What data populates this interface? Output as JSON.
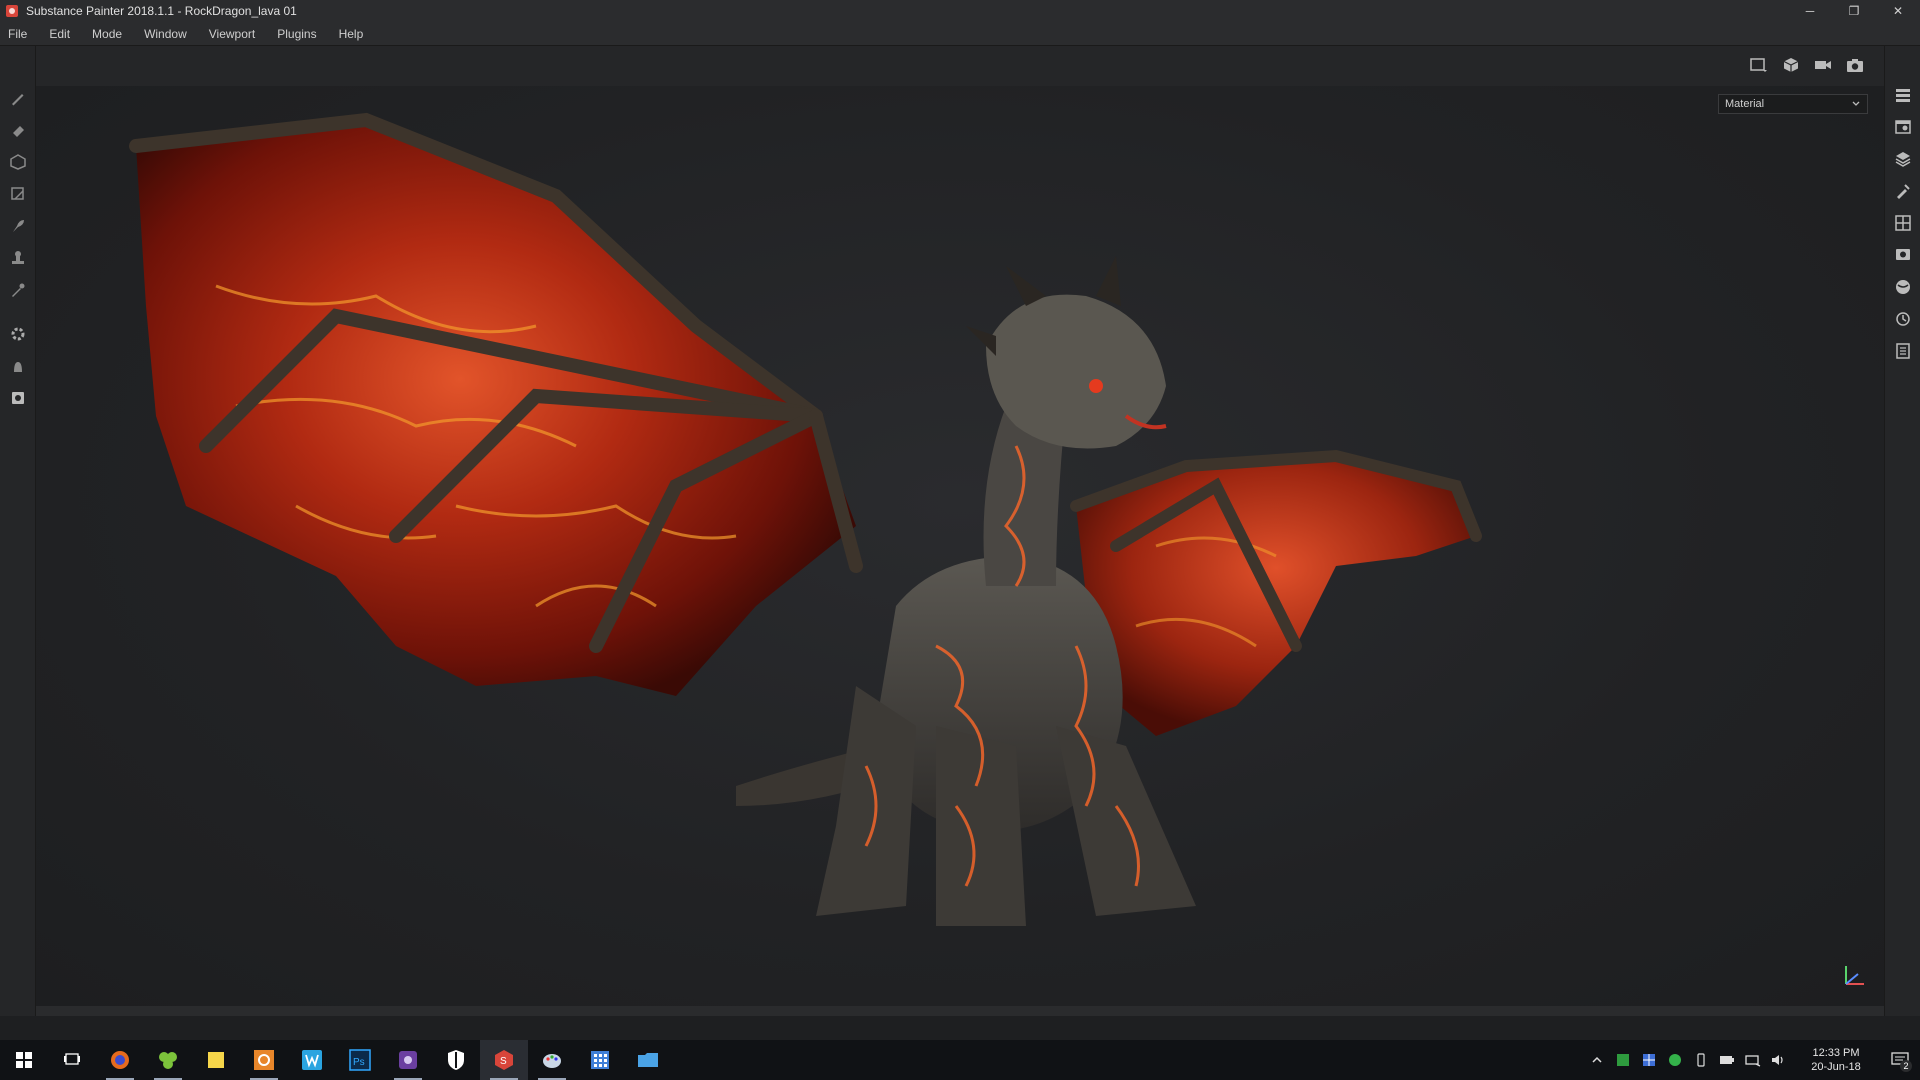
{
  "window": {
    "title": "Substance Painter 2018.1.1 - RockDragon_lava 01",
    "minimize_glyph": "─",
    "restore_glyph": "❐",
    "close_glyph": "✕"
  },
  "menu": {
    "items": [
      "File",
      "Edit",
      "Mode",
      "Window",
      "Viewport",
      "Plugins",
      "Help"
    ]
  },
  "viewport": {
    "render_mode": "Material"
  },
  "left_toolbar": {
    "icons": [
      "paint-brush-icon",
      "eraser-icon",
      "projection-icon",
      "polygon-fill-icon",
      "smudge-icon",
      "clone-icon",
      "color-picker-icon",
      "bake-icon",
      "python-icon",
      "export-icon"
    ]
  },
  "right_dock": {
    "icons": [
      "texture-set-list-icon",
      "texture-set-settings-icon",
      "layers-icon",
      "properties-icon",
      "display-settings-icon",
      "viewer-settings-icon",
      "shelf-icon",
      "history-icon",
      "log-icon"
    ]
  },
  "taskbar": {
    "apps": [
      "start-icon",
      "task-view-icon",
      "firefox-icon",
      "clover-icon",
      "sticky-notes-icon",
      "photos-icon",
      "word-icon",
      "photoshop-icon",
      "app-icon",
      "shield-icon",
      "substance-painter-icon",
      "paint-icon",
      "calculator-icon",
      "folder-icon"
    ],
    "time": "12:33 PM",
    "date": "20-Jun-18",
    "notification_count": "2"
  },
  "colors": {
    "accent": "#d8453a",
    "background": "#1d1e20",
    "panel": "#252628"
  }
}
